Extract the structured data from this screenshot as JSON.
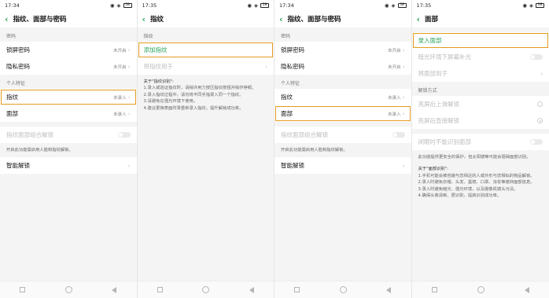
{
  "colors": {
    "accent": "#2aa35b",
    "highlight": "#e39a1f"
  },
  "s1": {
    "time": "17:34",
    "battery": "58",
    "title": "指纹、面部与密码",
    "section_password": "密码",
    "lock_password": "锁屏密码",
    "lock_password_value": "未开启",
    "privacy_password": "隐私密码",
    "privacy_password_value": "未开启",
    "section_personal": "个人特征",
    "fingerprint": "指纹",
    "fingerprint_value": "未录入",
    "face": "面部",
    "face_value": "未录入",
    "combo_unlock": "指纹面部组合解锁",
    "combo_note": "开启此功能需启用人脸和指纹解锁。",
    "smart_unlock": "智能解锁"
  },
  "s2": {
    "time": "17:35",
    "battery": "58",
    "title": "指纹",
    "section": "指纹",
    "add_fingerprint": "添加指纹",
    "fingerprint_use": "将指纹用于",
    "about_title": "关于\"指纹识别\":",
    "about_lines": [
      "1.录入或验证指纹时，请稍许用力按压指纹按钮并稍作停顿。",
      "2.录入指纹过程中，请勿将不同手指录入同一个指纹。",
      "3.请避免在强光环境下使用。",
      "4.建议更换表面时录重新录入指纹，提升解锁成功率。"
    ]
  },
  "s3": {
    "time": "17:34",
    "battery": "58",
    "title": "指纹、面部与密码",
    "section_password": "密码",
    "lock_password": "锁屏密码",
    "lock_password_value": "未开启",
    "privacy_password": "隐私密码",
    "privacy_password_value": "未开启",
    "section_personal": "个人特征",
    "fingerprint": "指纹",
    "fingerprint_value": "未录入",
    "face": "面部",
    "face_value": "未录入",
    "combo_unlock": "指纹面部组合解锁",
    "combo_note": "开启此功能需启用人脸和指纹解锁。",
    "smart_unlock": "智能解锁"
  },
  "s4": {
    "time": "17:35",
    "battery": "58",
    "title": "面部",
    "add_face": "录入面部",
    "dark_fill": "暗光环境下屏幕补光",
    "face_use": "将面部用于",
    "section_unlock": "解锁方式",
    "unlock_swipe": "亮屏后上滑解锁",
    "unlock_direct": "亮屏后直接解锁",
    "closed_eyes": "闭眼时不能识别面部",
    "closed_eyes_note": "此功能提供更安全的保护，但太阳镜等可能会阻碍面部识别。",
    "about_title": "关于\"面部识别\":",
    "about_lines": [
      "1.手机可能会被容貌与您相近的人或外形与您相似的物品解锁。",
      "2.录入时避免衣帽、头发、墨镜、口罩、浓妆等遮挡面部信息。",
      "3.录入时避免暗光、强光环境，以及摄像机镜头污渍。",
      "4.确保头像清晰、居识别，提高识别成功率。"
    ]
  }
}
